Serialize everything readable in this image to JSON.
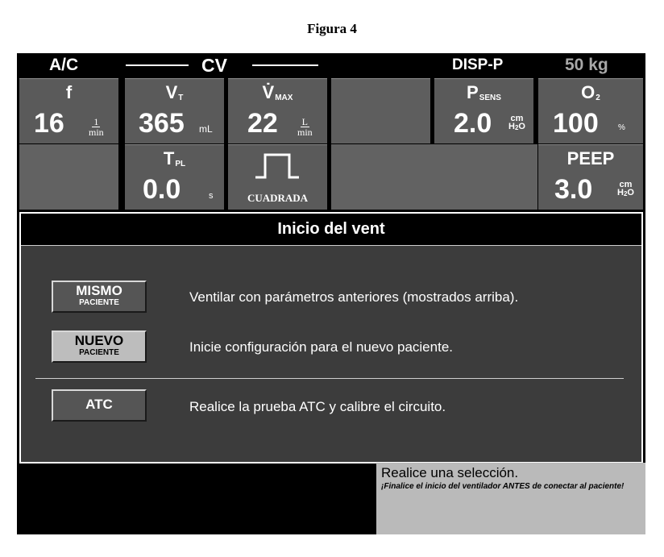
{
  "caption": "Figura 4",
  "header": {
    "mode": "A/C",
    "control": "CV",
    "trigger": "DISP-P",
    "weight": "50 kg"
  },
  "params": {
    "f": {
      "name": "f",
      "value": "16",
      "unit_num": "1",
      "unit_den": "min"
    },
    "vt": {
      "name": "V",
      "sub": "T",
      "value": "365",
      "unit": "mL"
    },
    "vmax": {
      "name": "V̇",
      "sub": "MAX",
      "value": "22",
      "unit_num": "L",
      "unit_den": "min"
    },
    "psens": {
      "name": "P",
      "sub": "SENS",
      "value": "2.0",
      "unit_top": "cm",
      "unit_bottom": "H",
      "unit_sub": "2",
      "unit_end": "O"
    },
    "o2": {
      "name": "O",
      "sub": "2",
      "value": "100",
      "unit": "%"
    },
    "tpl": {
      "name": "T",
      "sub": "PL",
      "value": "0.0",
      "unit": "s"
    },
    "waveform": {
      "label": "CUADRADA"
    },
    "peep": {
      "name": "PEEP",
      "value": "3.0",
      "unit_top": "cm",
      "unit_bottom": "H",
      "unit_sub": "2",
      "unit_end": "O"
    }
  },
  "dialog": {
    "title": "Inicio del vent",
    "options": [
      {
        "button_main": "MISMO",
        "button_sub": "PACIENTE",
        "text": "Ventilar con parámetros anteriores (mostrados arriba)."
      },
      {
        "button_main": "NUEVO",
        "button_sub": "PACIENTE",
        "text": "Inicie configuración para el nuevo paciente."
      },
      {
        "button_main": "ATC",
        "text": "Realice la prueba ATC y calibre el circuito."
      }
    ]
  },
  "message": {
    "main": "Realice una selección.",
    "sub": "¡Finalice el inicio del ventilador ANTES de conectar al paciente!"
  }
}
